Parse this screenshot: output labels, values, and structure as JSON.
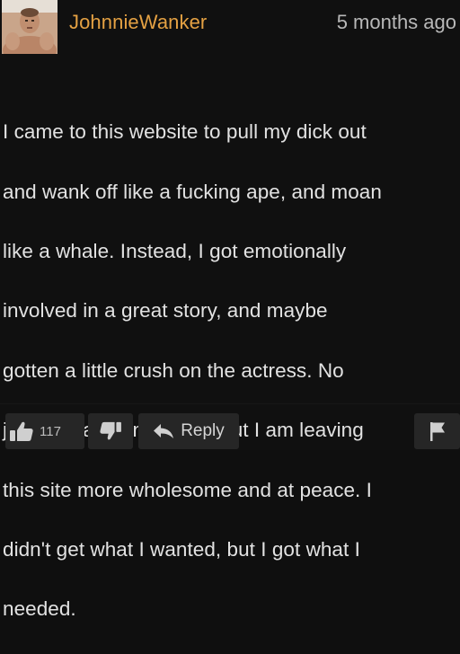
{
  "comment": {
    "username": "JohnnieWanker",
    "timestamp": "5 months ago",
    "text_lines": [
      "I came to this website to pull my dick out",
      "and wank off like a fucking ape, and moan",
      "like a whale. Instead, I got emotionally",
      "involved in a great story, and maybe",
      "gotten a little crush on the actress. No",
      "jerking was done today, but I am leaving",
      "this site more wholesome and at peace. I",
      "didn't get what I wanted, but I got what I",
      "needed."
    ]
  },
  "actions": {
    "like_count": "117",
    "reply_label": "Reply"
  },
  "colors": {
    "username": "#e4a143",
    "background": "#101010",
    "button_bg": "#262626"
  },
  "icons": {
    "avatar": "user-avatar-photo",
    "like": "thumbs-up-icon",
    "dislike": "thumbs-down-icon",
    "reply": "reply-arrow-icon",
    "flag": "flag-icon"
  }
}
